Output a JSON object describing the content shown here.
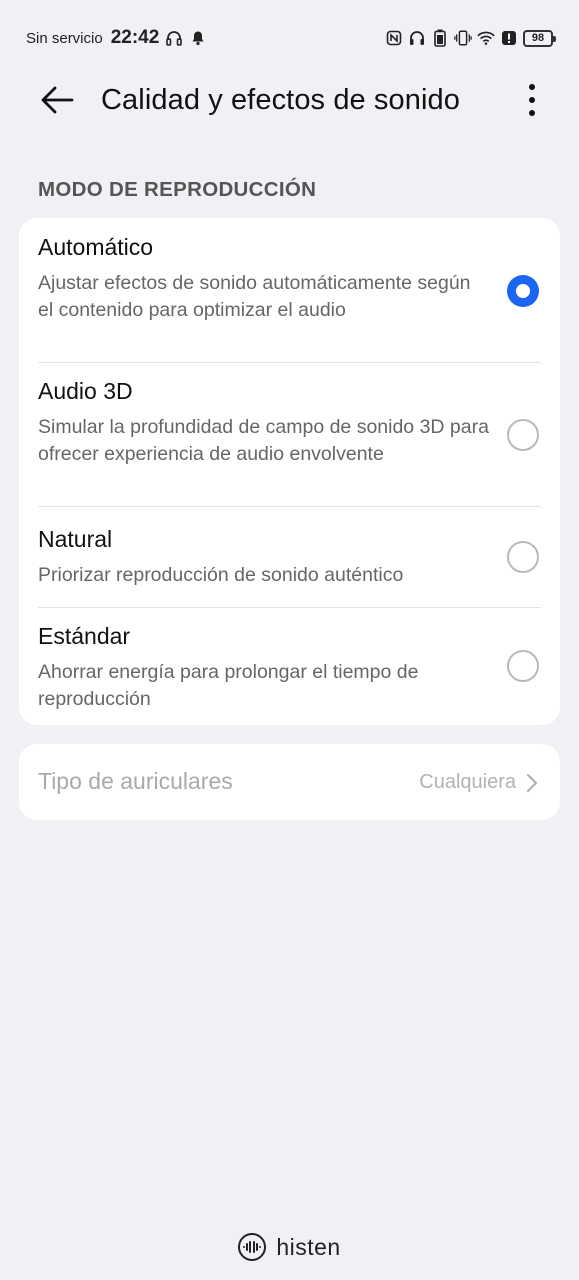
{
  "status_bar": {
    "carrier": "Sin servicio",
    "time": "22:42",
    "battery": "98",
    "left_icons": [
      "headphones-icon",
      "bell-icon"
    ],
    "right_icons": [
      "nfc-icon",
      "headphones-battery-icon",
      "battery-small-icon",
      "vibrate-icon",
      "wifi-icon",
      "alert-icon",
      "battery-icon"
    ]
  },
  "header": {
    "title": "Calidad y efectos de sonido",
    "back_icon": "arrow-left-icon",
    "more_icon": "more-vert-icon"
  },
  "section": {
    "label": "MODO DE REPRODUCCIÓN"
  },
  "modes": [
    {
      "title": "Automático",
      "description": "Ajustar efectos de sonido automáticamente según el contenido para optimizar el audio",
      "selected": true
    },
    {
      "title": "Audio 3D",
      "description": "Simular la profundidad de campo de sonido 3D para ofrecer experiencia de audio envolvente",
      "selected": false
    },
    {
      "title": "Natural",
      "description": "Priorizar reproducción de sonido auténtico",
      "selected": false
    },
    {
      "title": "Estándar",
      "description": "Ahorrar energía para prolongar el tiempo de reproducción",
      "selected": false
    }
  ],
  "headphones": {
    "label": "Tipo de auriculares",
    "value": "Cualquiera"
  },
  "footer": {
    "brand": "histen"
  },
  "colors": {
    "accent": "#1a66f2",
    "background": "#f0f1f5",
    "card": "#ffffff"
  }
}
